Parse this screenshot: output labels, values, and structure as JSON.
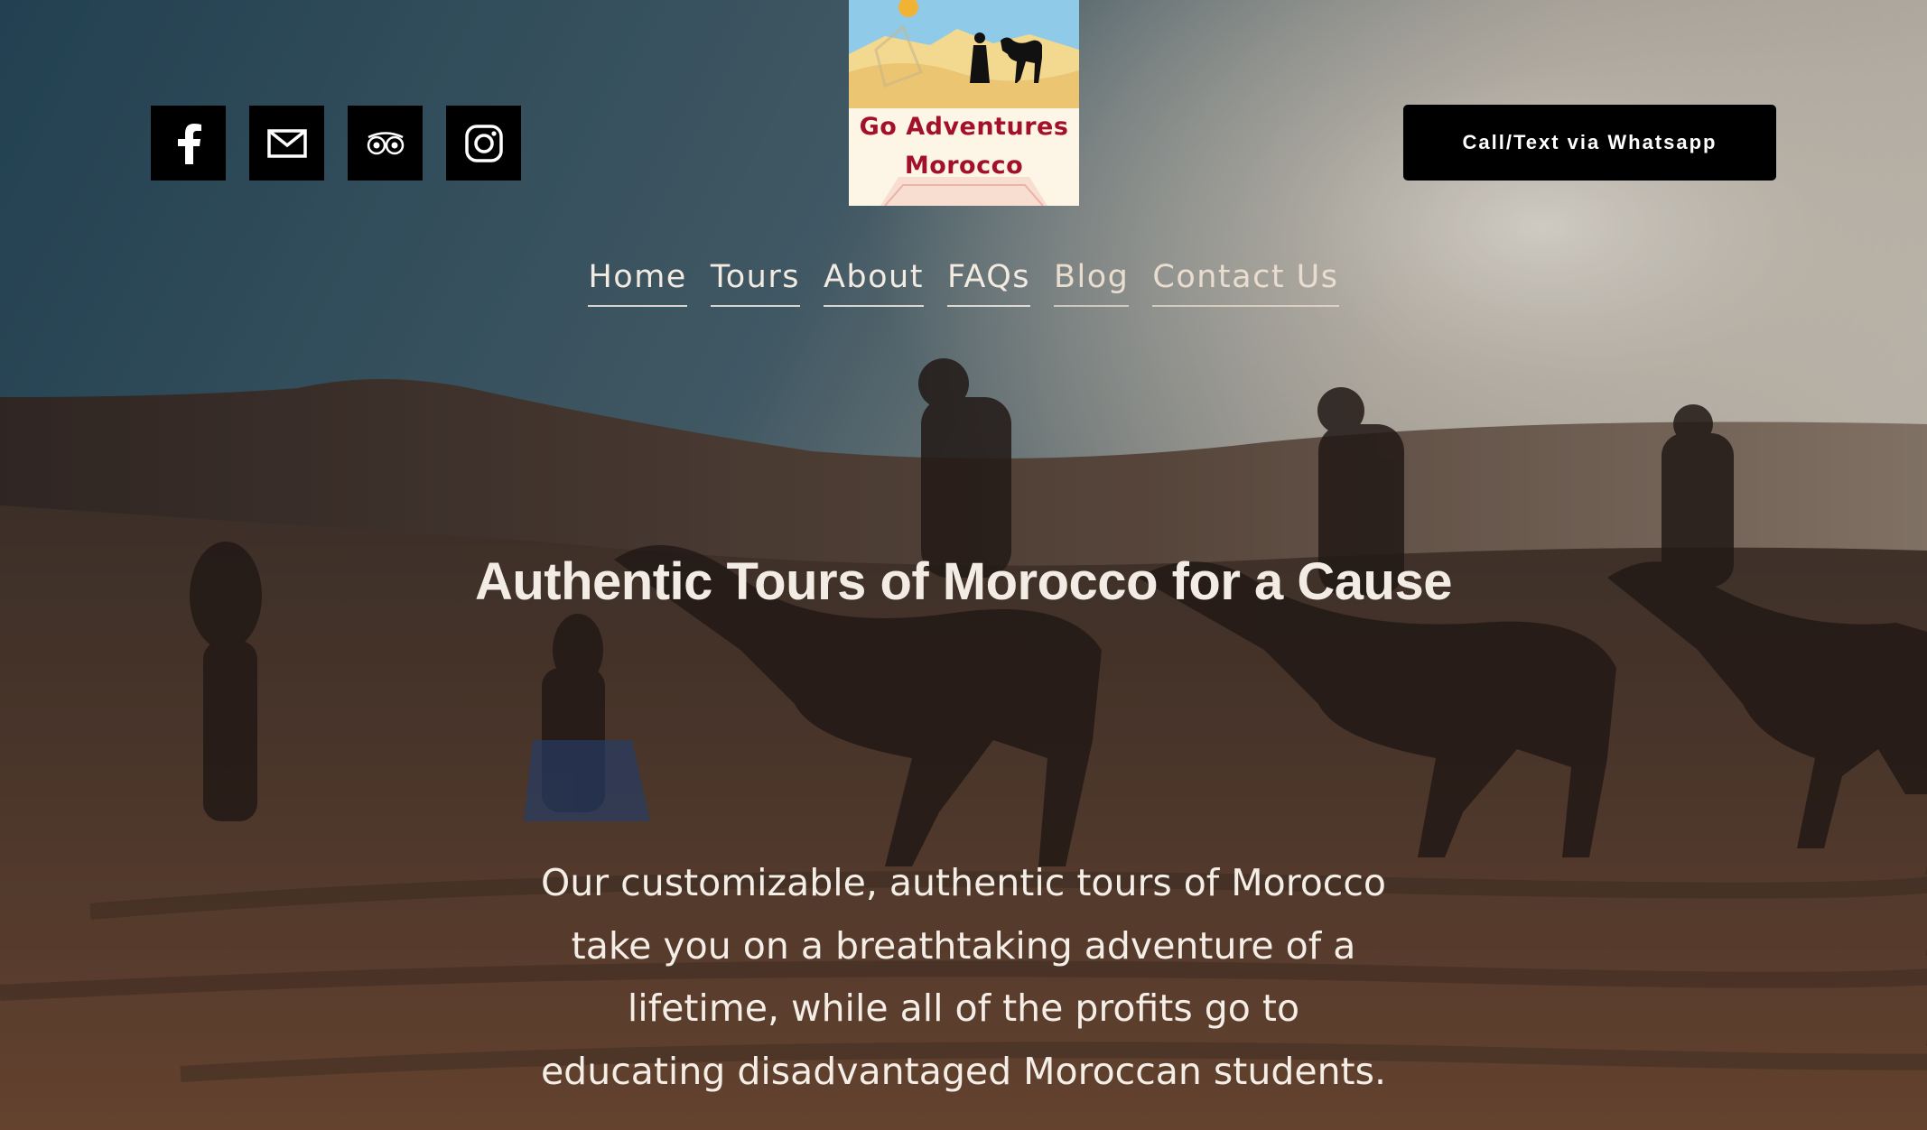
{
  "header": {
    "social": [
      {
        "name": "facebook",
        "icon": "facebook-icon"
      },
      {
        "name": "email",
        "icon": "mail-icon"
      },
      {
        "name": "tripadvisor",
        "icon": "tripadvisor-icon"
      },
      {
        "name": "instagram",
        "icon": "instagram-icon"
      }
    ],
    "logo": {
      "line1": "Go Adventures",
      "line2": "Morocco"
    },
    "cta_label": "Call/Text via Whatsapp"
  },
  "nav": {
    "items": [
      "Home",
      "Tours",
      "About",
      "FAQs",
      "Blog",
      "Contact Us"
    ]
  },
  "hero": {
    "headline": "Authentic Tours of Morocco for a Cause",
    "description": "Our customizable, authentic tours of Morocco take you on a breathtaking adventure of a lifetime, while all of the profits go to educating disadvantaged Moroccan students."
  },
  "colors": {
    "button_bg": "#000000",
    "text_light": "#f2ece4",
    "logo_red": "#a3102a"
  }
}
